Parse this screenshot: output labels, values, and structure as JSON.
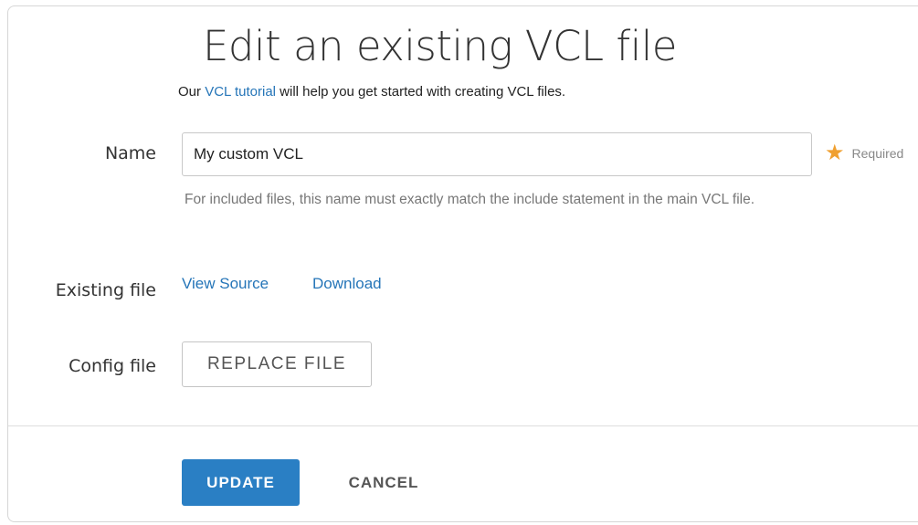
{
  "dialog": {
    "title": "Edit an existing VCL file",
    "subtitle": {
      "prefix": "Our ",
      "link": "VCL tutorial",
      "suffix": " will help you get started with creating VCL files."
    }
  },
  "form": {
    "name": {
      "label": "Name",
      "value": "My custom VCL",
      "required_text": "Required",
      "help": "For included files, this name must exactly match the include statement in the main VCL file."
    },
    "existing_file": {
      "label": "Existing file",
      "view_source": "View Source",
      "download": "Download"
    },
    "config_file": {
      "label": "Config file",
      "replace_button": "REPLACE FILE"
    }
  },
  "actions": {
    "update": "UPDATE",
    "cancel": "CANCEL"
  },
  "colors": {
    "primary": "#2a7fc4",
    "link": "#2575b8",
    "required_star": "#f0a030"
  }
}
